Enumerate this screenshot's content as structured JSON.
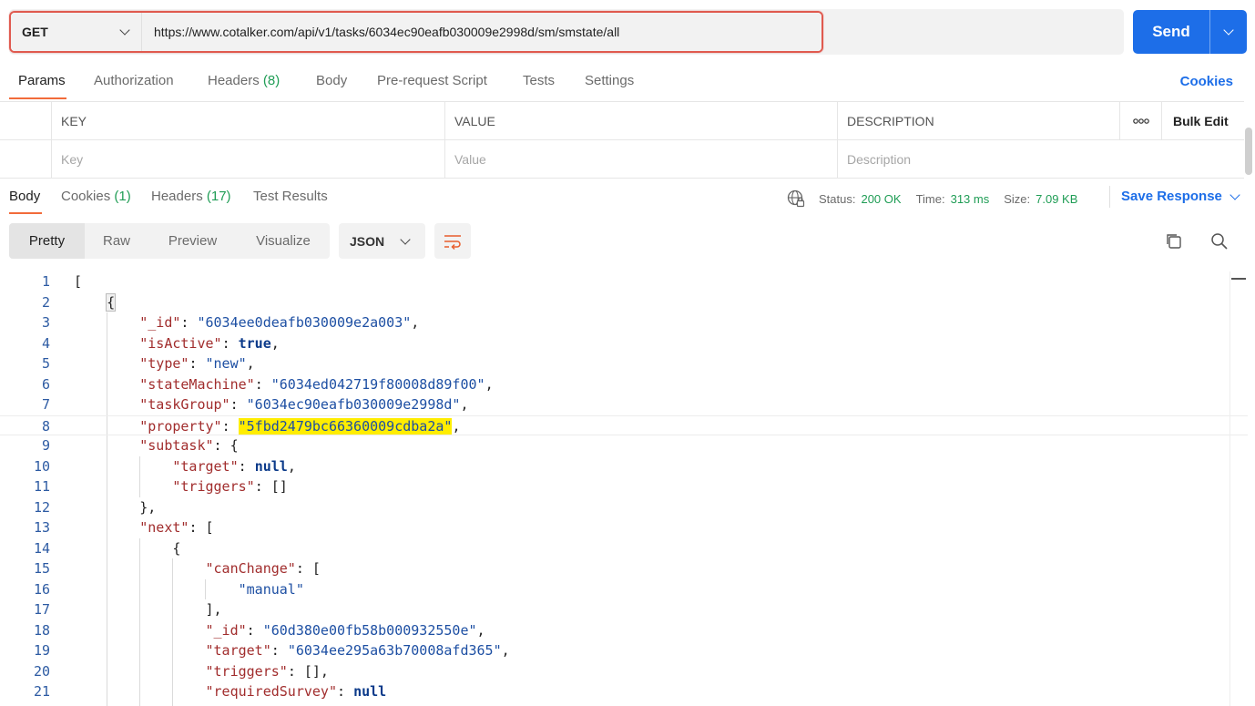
{
  "request": {
    "method": "GET",
    "url": "https://www.cotalker.com/api/v1/tasks/6034ec90eafb030009e2998d/sm/smstate/all",
    "send_label": "Send"
  },
  "request_tabs": [
    {
      "label": "Params"
    },
    {
      "label": "Authorization"
    },
    {
      "label": "Headers",
      "count": "(8)"
    },
    {
      "label": "Body"
    },
    {
      "label": "Pre-request Script"
    },
    {
      "label": "Tests"
    },
    {
      "label": "Settings"
    }
  ],
  "cookies_label": "Cookies",
  "params": {
    "headers": {
      "key": "KEY",
      "value": "VALUE",
      "description": "DESCRIPTION",
      "bulk_edit": "Bulk Edit"
    },
    "placeholders": {
      "key": "Key",
      "value": "Value",
      "description": "Description"
    }
  },
  "response_tabs": [
    {
      "label": "Body"
    },
    {
      "label": "Cookies",
      "count": "(1)"
    },
    {
      "label": "Headers",
      "count": "(17)"
    },
    {
      "label": "Test Results"
    }
  ],
  "response_meta": {
    "status_label": "Status:",
    "status_value": "200 OK",
    "time_label": "Time:",
    "time_value": "313 ms",
    "size_label": "Size:",
    "size_value": "7.09 KB",
    "save_label": "Save Response"
  },
  "viewer": {
    "modes": [
      "Pretty",
      "Raw",
      "Preview",
      "Visualize"
    ],
    "format": "JSON"
  },
  "code_lines": [
    {
      "n": "1"
    },
    {
      "n": "2"
    },
    {
      "n": "3"
    },
    {
      "n": "4"
    },
    {
      "n": "5"
    },
    {
      "n": "6"
    },
    {
      "n": "7"
    },
    {
      "n": "8"
    },
    {
      "n": "9"
    },
    {
      "n": "10"
    },
    {
      "n": "11"
    },
    {
      "n": "12"
    },
    {
      "n": "13"
    },
    {
      "n": "14"
    },
    {
      "n": "15"
    },
    {
      "n": "16"
    },
    {
      "n": "17"
    },
    {
      "n": "18"
    },
    {
      "n": "19"
    },
    {
      "n": "20"
    },
    {
      "n": "21"
    }
  ],
  "json": {
    "id": "\"6034ee0deafb030009e2a003\"",
    "isActive": "true",
    "type": "\"new\"",
    "stateMachine": "\"6034ed042719f80008d89f00\"",
    "taskGroup": "\"6034ec90eafb030009e2998d\"",
    "property": "\"5fbd2479bc66360009cdba2a\"",
    "subtask_target": "null",
    "canChange_item": "\"manual\"",
    "next_id": "\"60d380e00fb58b000932550e\"",
    "next_target": "\"6034ee295a63b70008afd365\"",
    "requiredSurvey": "null"
  },
  "keys": {
    "id": "\"_id\"",
    "isActive": "\"isActive\"",
    "type": "\"type\"",
    "stateMachine": "\"stateMachine\"",
    "taskGroup": "\"taskGroup\"",
    "property": "\"property\"",
    "subtask": "\"subtask\"",
    "target": "\"target\"",
    "triggers": "\"triggers\"",
    "next": "\"next\"",
    "canChange": "\"canChange\"",
    "requiredSurvey": "\"requiredSurvey\""
  }
}
